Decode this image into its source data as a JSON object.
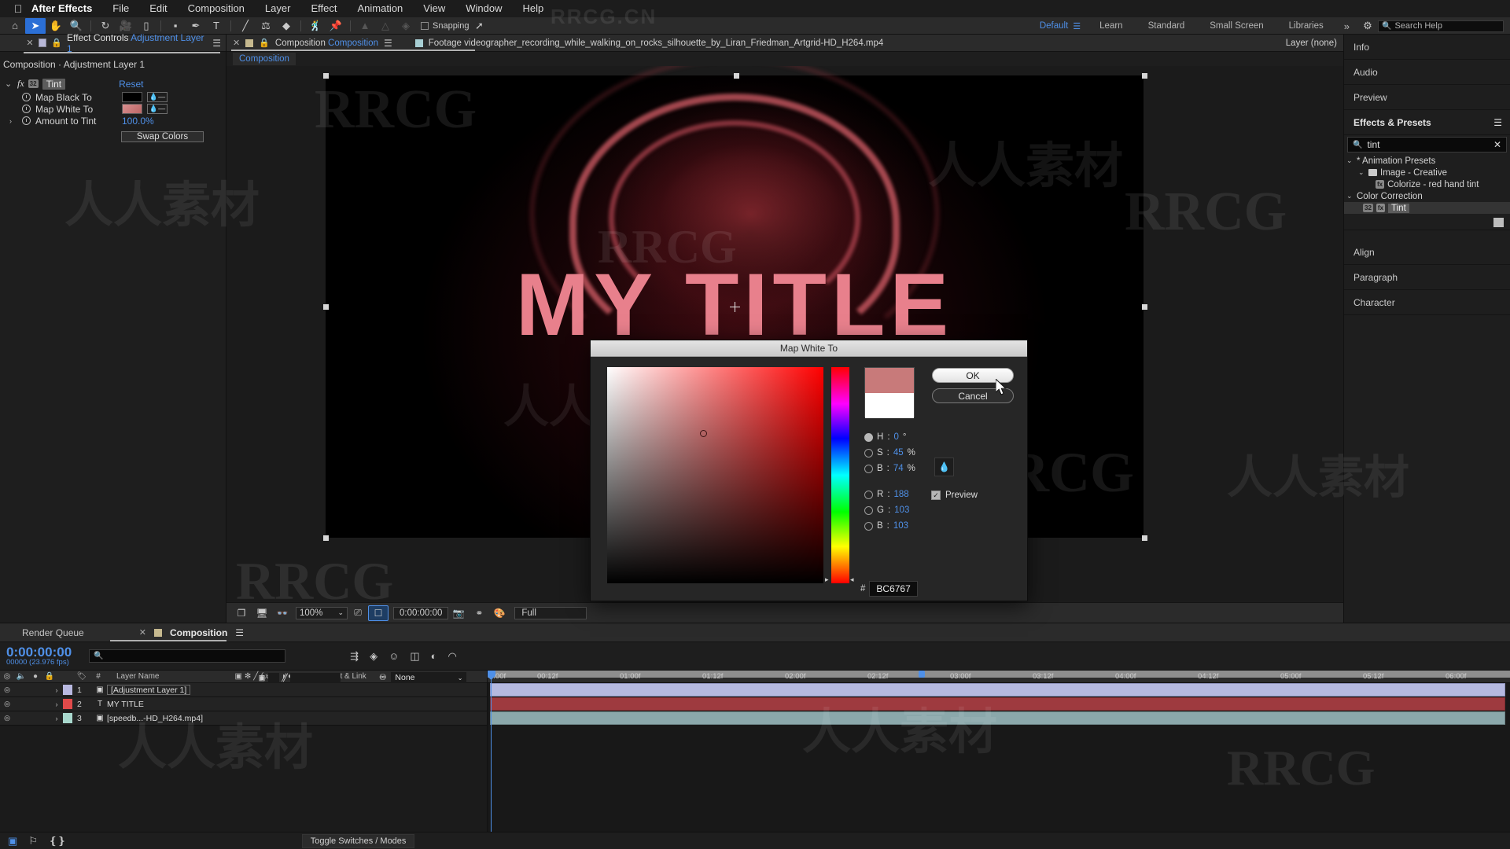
{
  "app": {
    "name": "After Effects",
    "apple_icon": "apple-icon"
  },
  "menubar": {
    "items": [
      "After Effects",
      "File",
      "Edit",
      "Composition",
      "Layer",
      "Effect",
      "Animation",
      "View",
      "Window",
      "Help"
    ]
  },
  "toolbar": {
    "tools": [
      "home-icon",
      "selection-icon",
      "hand-icon",
      "zoom-icon",
      "rotation-icon",
      "camera-icon",
      "pan-behind-icon",
      "shape-icon",
      "pen-icon",
      "text-icon",
      "brush-icon",
      "clone-stamp-icon",
      "eraser-icon",
      "roto-brush-icon",
      "puppet-pin-icon",
      "puppet-starch-icon",
      "puppet-overlap-icon",
      "puppet-advanced-icon"
    ],
    "snapping_label": "Snapping"
  },
  "workspace": {
    "items": [
      "Default",
      "Learn",
      "Standard",
      "Small Screen",
      "Libraries"
    ],
    "active": "Default",
    "chevron": "»",
    "search_help_placeholder": "Search Help"
  },
  "effect_controls": {
    "tab_label": "Effect Controls",
    "tab_target": "Adjustment Layer 1",
    "breadcrumb": "Composition · Adjustment Layer 1",
    "effect_name": "Tint",
    "reset_label": "Reset",
    "badge": "32",
    "properties": [
      {
        "label": "Map Black To",
        "type": "swatch",
        "value": "#000000"
      },
      {
        "label": "Map White To",
        "type": "swatch",
        "value": "#BC6767"
      },
      {
        "label": "Amount to Tint",
        "type": "value",
        "value": "100.0%"
      }
    ],
    "swap_colors_label": "Swap Colors"
  },
  "composition_panel": {
    "tab_label": "Composition",
    "tab_name": "Composition",
    "footage_label": "Footage",
    "footage_name": "videographer_recording_while_walking_on_rocks_silhouette_by_Liran_Friedman_Artgrid-HD_H264.mp4",
    "layer_label": "Layer (none)",
    "breadcrumb": "Composition",
    "title_text": "MY TITLE",
    "viewbar": {
      "zoom": "100%",
      "timecode": "0:00:00:00",
      "resolution": "Full",
      "icons": [
        "take-snapshot-icon",
        "show-channel-icon",
        "region-of-interest-icon",
        "toggle-transparency-icon",
        "camera-icon",
        "grid-icon",
        "color-management-icon"
      ]
    }
  },
  "right_panels": {
    "collapsed_top": [
      "Info",
      "Audio",
      "Preview"
    ],
    "effects_presets": {
      "title": "Effects & Presets",
      "menu_icon": "panel-menu-icon",
      "search_value": "tint",
      "clear_icon": "clear-icon",
      "tree": [
        {
          "depth": 0,
          "label": "* Animation Presets",
          "arrow": "⌄",
          "type": "group"
        },
        {
          "depth": 1,
          "label": "Image - Creative",
          "arrow": "⌄",
          "type": "folder"
        },
        {
          "depth": 2,
          "label": "Colorize - red hand tint",
          "type": "preset"
        },
        {
          "depth": 0,
          "label": "Color Correction",
          "arrow": "⌄",
          "type": "group"
        },
        {
          "depth": 1,
          "label": "Tint",
          "type": "effect",
          "selected": true,
          "badges": [
            "32",
            "fx"
          ]
        }
      ]
    },
    "collapsed_bottom": [
      "Align",
      "Paragraph",
      "Character"
    ]
  },
  "timeline": {
    "tabs": {
      "render_queue": "Render Queue",
      "composition": "Composition"
    },
    "current_time": "0:00:00:00",
    "frame_info": "00000 (23.976 fps)",
    "search_placeholder": "",
    "column_headers": {
      "number": "#",
      "layer_name": "Layer Name",
      "parent_link": "Parent & Link",
      "switch_icons": [
        "shy-icon",
        "collapse-icon",
        "quality-icon",
        "effects-icon",
        "frame-blend-icon",
        "motion-blur-icon",
        "adjustment-icon",
        "3d-layer-icon"
      ]
    },
    "layers": [
      {
        "index": "1",
        "name": "[Adjustment Layer 1]",
        "type_icon": "adjustment-layer-icon",
        "color": "#b8b8e0",
        "parent": "None",
        "bar_color": "#b5b9e0",
        "selected": true
      },
      {
        "index": "2",
        "name": "MY TITLE",
        "type_icon": "text-layer-icon",
        "color": "#e04a4a",
        "parent": "None",
        "bar_color": "#9e3a3f"
      },
      {
        "index": "3",
        "name": "[speedb...-HD_H264.mp4]",
        "type_icon": "video-layer-icon",
        "color": "#a8d8cd",
        "parent": "None",
        "bar_color": "#8ba8ab"
      }
    ],
    "ruler_ticks": [
      "0:00f",
      "00:12f",
      "01:00f",
      "01:12f",
      "02:00f",
      "02:12f",
      "03:00f",
      "03:12f",
      "04:00f",
      "04:12f",
      "05:00f",
      "05:12f",
      "06:00f"
    ],
    "toggle_switches_label": "Toggle Switches / Modes"
  },
  "color_picker": {
    "title": "Map White To",
    "ok_label": "OK",
    "cancel_label": "Cancel",
    "preview_label": "Preview",
    "preview_checked": true,
    "eyedropper_icon": "eyedropper-icon",
    "new_color": "#BC6767",
    "previous_color": "#FFFFFF",
    "hex_symbol": "#",
    "hex_value": "BC6767",
    "fields": [
      {
        "key": "H",
        "value": "0",
        "unit": "°",
        "selected": true
      },
      {
        "key": "S",
        "value": "45",
        "unit": "%",
        "selected": false
      },
      {
        "key": "B",
        "value": "74",
        "unit": "%",
        "selected": false
      },
      {
        "key": "R",
        "value": "188",
        "unit": "",
        "selected": false
      },
      {
        "key": "G",
        "value": "103",
        "unit": "",
        "selected": false
      },
      {
        "key": "B",
        "value": "103",
        "unit": "",
        "selected": false
      }
    ]
  },
  "watermarks": {
    "brand": "RRCG",
    "domain": "RRCG.CN",
    "cn": "人人素材"
  },
  "colors": {
    "accent": "#4f90e8",
    "picked": "#BC6767",
    "title_text": "#e8808c"
  }
}
